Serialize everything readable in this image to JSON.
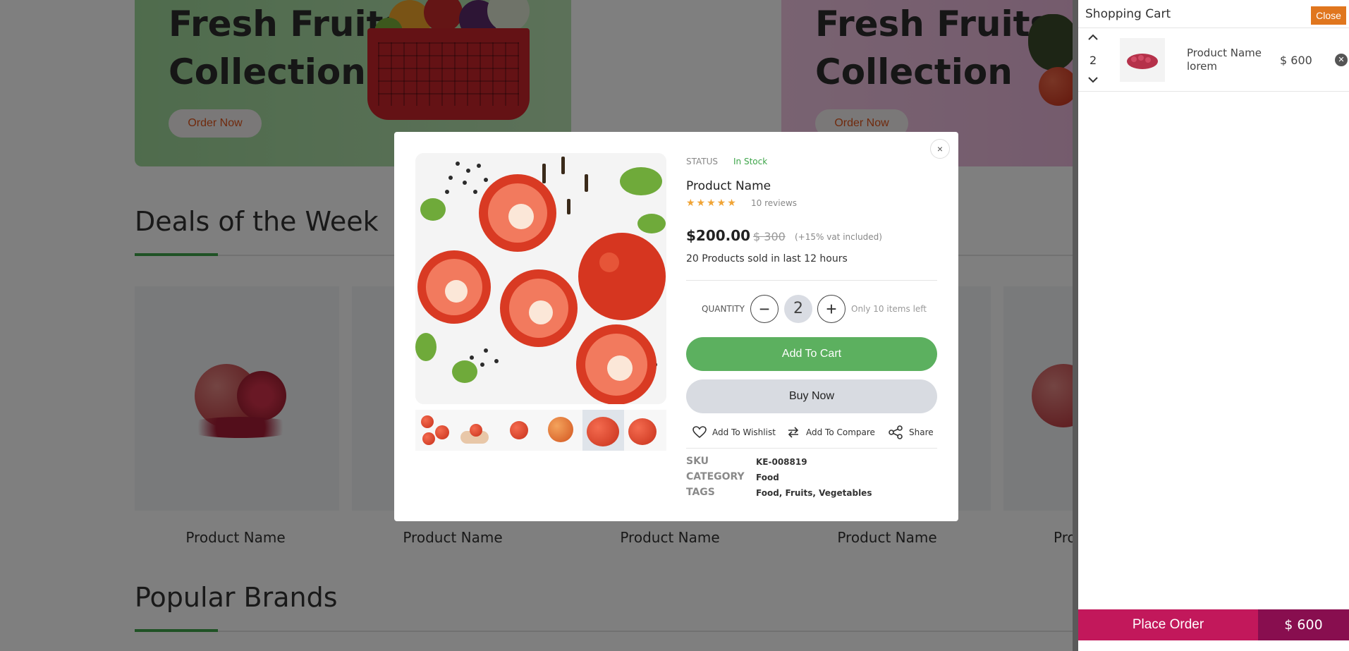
{
  "banners": [
    {
      "title_line1": "Fresh Fruits",
      "title_line2": "Collection",
      "button": "Order Now"
    },
    {
      "title_line1": "Fresh Fruits",
      "title_line2": "Collection",
      "button": "Order Now"
    }
  ],
  "deals": {
    "title": "Deals of the Week",
    "cards": [
      "Product Name",
      "Product Name",
      "Product Name",
      "Product Name",
      "Pro"
    ]
  },
  "brands": {
    "title": "Popular Brands"
  },
  "modal": {
    "close_glyph": "×",
    "status_label": "STATUS",
    "status_value": "In Stock",
    "product_name": "Product Name",
    "rating": 5,
    "stars": "★★★★★",
    "reviews": "10 reviews",
    "price": "$200.00",
    "old_price": "$ 300",
    "vat": "(+15% vat included)",
    "sold": "20 Products sold in last 12 hours",
    "quantity_label": "QUANTITY",
    "quantity_value": "2",
    "minus": "−",
    "plus": "+",
    "stock_left": "Only 10 items left",
    "add_to_cart": "Add To Cart",
    "buy_now": "Buy Now",
    "actions": {
      "wishlist": "Add To Wishlist",
      "compare": "Add To Compare",
      "share": "Share"
    },
    "meta": [
      {
        "key": "SKU",
        "value": "KE-008819"
      },
      {
        "key": "CATEGORY",
        "value": "Food"
      },
      {
        "key": "TAGS",
        "value": "Food, Fruits, Vegetables"
      }
    ],
    "thumbnail_count": 6,
    "selected_thumbnail": 5
  },
  "cart": {
    "title": "Shopping Cart",
    "close": "Close",
    "items": [
      {
        "qty": "2",
        "name": "Product Name lorem",
        "price": "$ 600"
      }
    ],
    "place_order": "Place Order",
    "total": "$ 600"
  },
  "colors": {
    "accent_green": "#5cb05f",
    "cart_close": "#e0761e",
    "place_order": "#c2185b",
    "order_total": "#880e4f"
  }
}
